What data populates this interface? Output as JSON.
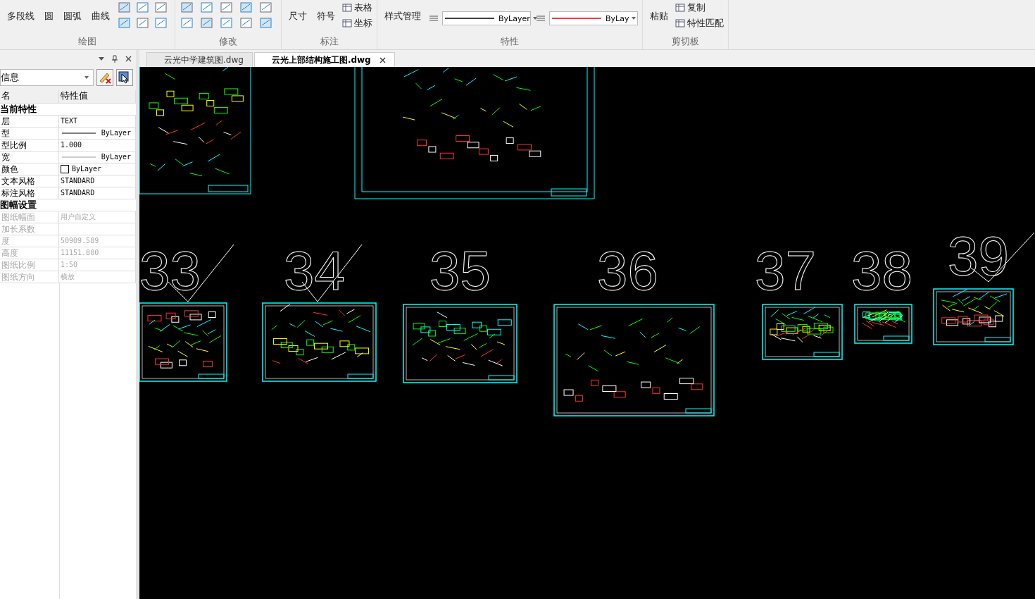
{
  "ribbon": {
    "groups": [
      {
        "title": "绘图",
        "tools": [
          {
            "kind": "large",
            "label": "多段线"
          },
          {
            "kind": "large",
            "label": "圆"
          },
          {
            "kind": "large",
            "label": "圆弧"
          },
          {
            "kind": "large",
            "label": "曲线"
          },
          {
            "kind": "icons"
          }
        ]
      },
      {
        "title": "修改",
        "tools": [
          {
            "kind": "icons"
          }
        ]
      },
      {
        "title": "标注",
        "tools": [
          {
            "kind": "large",
            "label": "尺寸"
          },
          {
            "kind": "large",
            "label": "符号"
          },
          {
            "kind": "small",
            "label": "表格"
          },
          {
            "kind": "small",
            "label": "坐标"
          }
        ]
      },
      {
        "title": "特性",
        "tools": [
          {
            "kind": "large",
            "label": "样式管理"
          },
          {
            "kind": "linetype",
            "value": "ByLayer"
          },
          {
            "kind": "lineweight",
            "value": "ByLay"
          }
        ]
      },
      {
        "title": "剪切板",
        "tools": [
          {
            "kind": "large",
            "label": "粘贴"
          },
          {
            "kind": "small",
            "label": "复制"
          },
          {
            "kind": "small",
            "label": "特性匹配"
          }
        ]
      }
    ]
  },
  "documents": [
    {
      "label": "云光中学建筑图.dwg",
      "selected": false
    },
    {
      "label": "云光上部结构施工图.dwg",
      "selected": true
    }
  ],
  "properties": {
    "selector": "信息",
    "columns": [
      "名",
      "特性值"
    ],
    "sections": [
      {
        "title": "当前特性",
        "rows": [
          {
            "name": "层",
            "value": "TEXT",
            "kind": "text",
            "disabled": false
          },
          {
            "name": "型",
            "value": "ByLayer",
            "kind": "line",
            "disabled": false
          },
          {
            "name": "型比例",
            "value": "1.000",
            "kind": "text",
            "disabled": false
          },
          {
            "name": "宽",
            "value": "ByLayer",
            "kind": "thinline",
            "disabled": false
          },
          {
            "name": "颜色",
            "value": "ByLayer",
            "kind": "swatch",
            "disabled": false
          },
          {
            "name": "文本风格",
            "value": "STANDARD",
            "kind": "text",
            "disabled": false
          },
          {
            "name": "标注风格",
            "value": "STANDARD",
            "kind": "text",
            "disabled": false
          }
        ]
      },
      {
        "title": "图幅设置",
        "rows": [
          {
            "name": "图纸幅面",
            "value": "用户自定义",
            "kind": "text",
            "disabled": true
          },
          {
            "name": "加长系数",
            "value": "",
            "kind": "text",
            "disabled": true
          },
          {
            "name": "度",
            "value": "50909.589",
            "kind": "text",
            "disabled": true
          },
          {
            "name": "高度",
            "value": "11151.800",
            "kind": "text",
            "disabled": true
          },
          {
            "name": "图纸比例",
            "value": "1:50",
            "kind": "text",
            "disabled": true
          },
          {
            "name": "图纸方向",
            "value": "横放",
            "kind": "text",
            "disabled": true
          }
        ]
      }
    ]
  },
  "canvas": {
    "sheets": [
      {
        "number": "33",
        "checked": true
      },
      {
        "number": "34",
        "checked": true
      },
      {
        "number": "35",
        "checked": false
      },
      {
        "number": "36",
        "checked": false
      },
      {
        "number": "37",
        "checked": false
      },
      {
        "number": "38",
        "checked": false
      },
      {
        "number": "39",
        "checked": true
      }
    ]
  }
}
